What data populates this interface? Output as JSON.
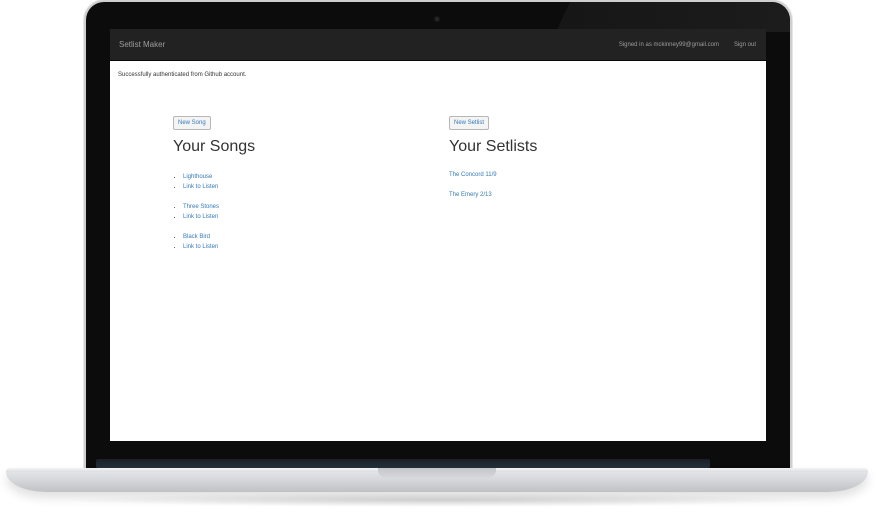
{
  "navbar": {
    "brand": "Setlist Maker",
    "signed_in_text": "Signed in as mckinney99@gmail.com",
    "sign_out_label": "Sign out"
  },
  "flash": {
    "message": "Successfully authenticated from Github account."
  },
  "songs": {
    "new_button_label": "New Song",
    "heading": "Your Songs",
    "items": [
      {
        "title": "Lighthouse",
        "listen_label": "Link to Listen"
      },
      {
        "title": "Three Stones",
        "listen_label": "Link to Listen"
      },
      {
        "title": "Black Bird",
        "listen_label": "Link to Listen"
      }
    ]
  },
  "setlists": {
    "new_button_label": "New Setlist",
    "heading": "Your Setlists",
    "items": [
      "The Concord 11/9",
      "The Emery 2/13"
    ]
  }
}
